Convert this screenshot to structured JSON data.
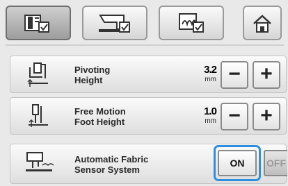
{
  "tabs": [
    {
      "name": "machine-settings",
      "active": true
    },
    {
      "name": "sewing-settings",
      "active": false
    },
    {
      "name": "embroidery-settings",
      "active": false
    }
  ],
  "home": {
    "icon": "home-icon"
  },
  "rows": [
    {
      "label_line1": "Pivoting",
      "label_line2": "Height",
      "value": "3.2",
      "unit": "mm",
      "minus": "−",
      "plus": "+"
    },
    {
      "label_line1": "Free Motion",
      "label_line2": "Foot Height",
      "value": "1.0",
      "unit": "mm",
      "minus": "−",
      "plus": "+"
    },
    {
      "label_line1": "Automatic Fabric",
      "label_line2": "Sensor System",
      "on_label": "ON",
      "off_label": "OFF",
      "selected": "ON"
    }
  ],
  "colors": {
    "focus": "#2f8ee0",
    "active_tab": "#a8a8a8"
  }
}
